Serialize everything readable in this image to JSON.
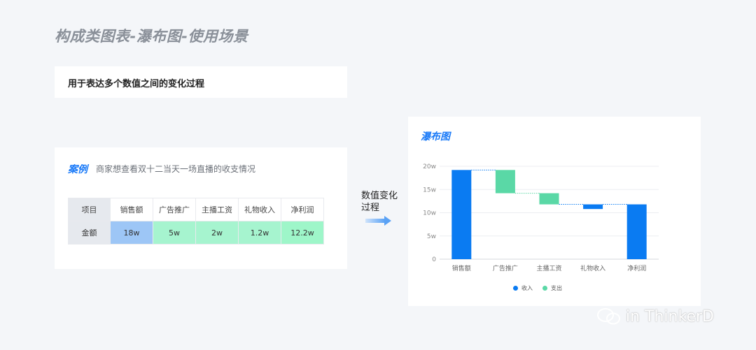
{
  "page": {
    "title": "构成类图表-瀑布图-使用场景"
  },
  "description": {
    "text": "用于表达多个数值之间的变化过程"
  },
  "case": {
    "title": "案例",
    "subtitle": "商家想查看双十二当天一场直播的收支情况",
    "table": {
      "row1": [
        "项目",
        "销售额",
        "广告推广",
        "主播工资",
        "礼物收入",
        "净利润"
      ],
      "row2": [
        "金额",
        "18w",
        "5w",
        "2w",
        "1.2w",
        "12.2w"
      ]
    }
  },
  "arrow": {
    "label": "数值变化过程"
  },
  "chart": {
    "title": "瀑布图",
    "legend": {
      "income": "收入",
      "expense": "支出"
    }
  },
  "chart_data": {
    "type": "bar",
    "categories": [
      "销售额",
      "广告推广",
      "主播工资",
      "礼物收入",
      "净利润"
    ],
    "y_ticks": [
      "0",
      "5w",
      "10w",
      "15w",
      "20w"
    ],
    "ylim": [
      0,
      20
    ],
    "series": [
      {
        "name": "收入",
        "bars": [
          [
            0,
            19.2
          ],
          null,
          null,
          [
            10.8,
            11.8
          ],
          [
            0,
            11.8
          ]
        ]
      },
      {
        "name": "支出",
        "bars": [
          null,
          [
            14.2,
            19.2
          ],
          [
            11.8,
            14.2
          ],
          null,
          null
        ]
      }
    ],
    "colors": {
      "income": "#0a7bf2",
      "expense": "#5ad8a6"
    },
    "grid": true
  },
  "watermark": {
    "text": "in ThinkerD"
  }
}
